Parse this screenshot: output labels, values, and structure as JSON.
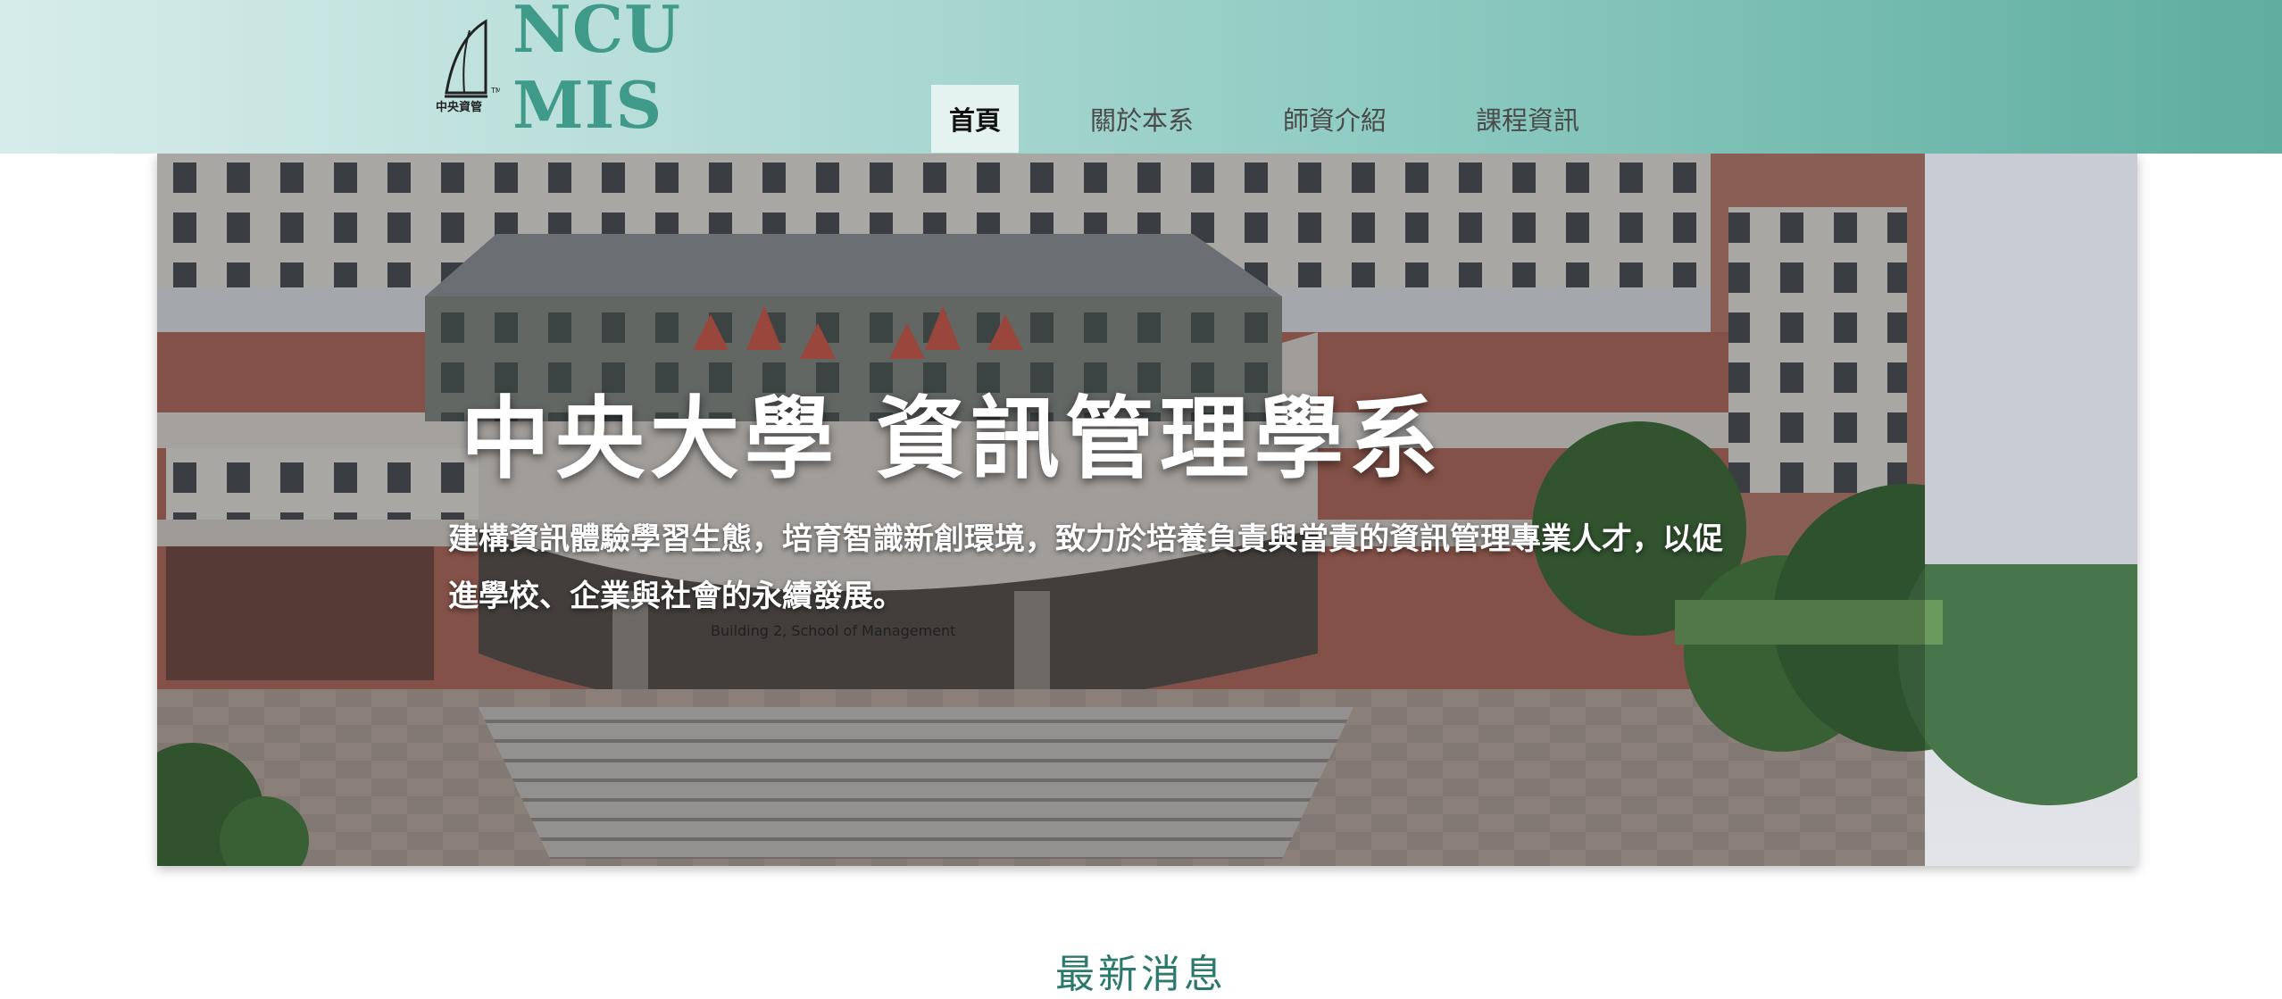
{
  "header": {
    "logo_text": "NCU MIS",
    "logo_small_text": "中央資管"
  },
  "nav": {
    "items": [
      {
        "label": "首頁",
        "active": true
      },
      {
        "label": "關於本系",
        "active": false
      },
      {
        "label": "師資介紹",
        "active": false
      },
      {
        "label": "課程資訊",
        "active": false
      }
    ]
  },
  "hero": {
    "title": "中央大學 資訊管理學系",
    "description": "建構資訊體驗學習生態，培育智識新創環境，致力於培養負責與當責的資訊管理專業人才，以促進學校、企業與社會的永續發展。",
    "building_sign": "Building 2, School of Management"
  },
  "main": {
    "section_title": "最新消息"
  },
  "colors": {
    "brand": "#3f9a89",
    "header_start": "#d6ecea",
    "header_end": "#5fae9f"
  }
}
